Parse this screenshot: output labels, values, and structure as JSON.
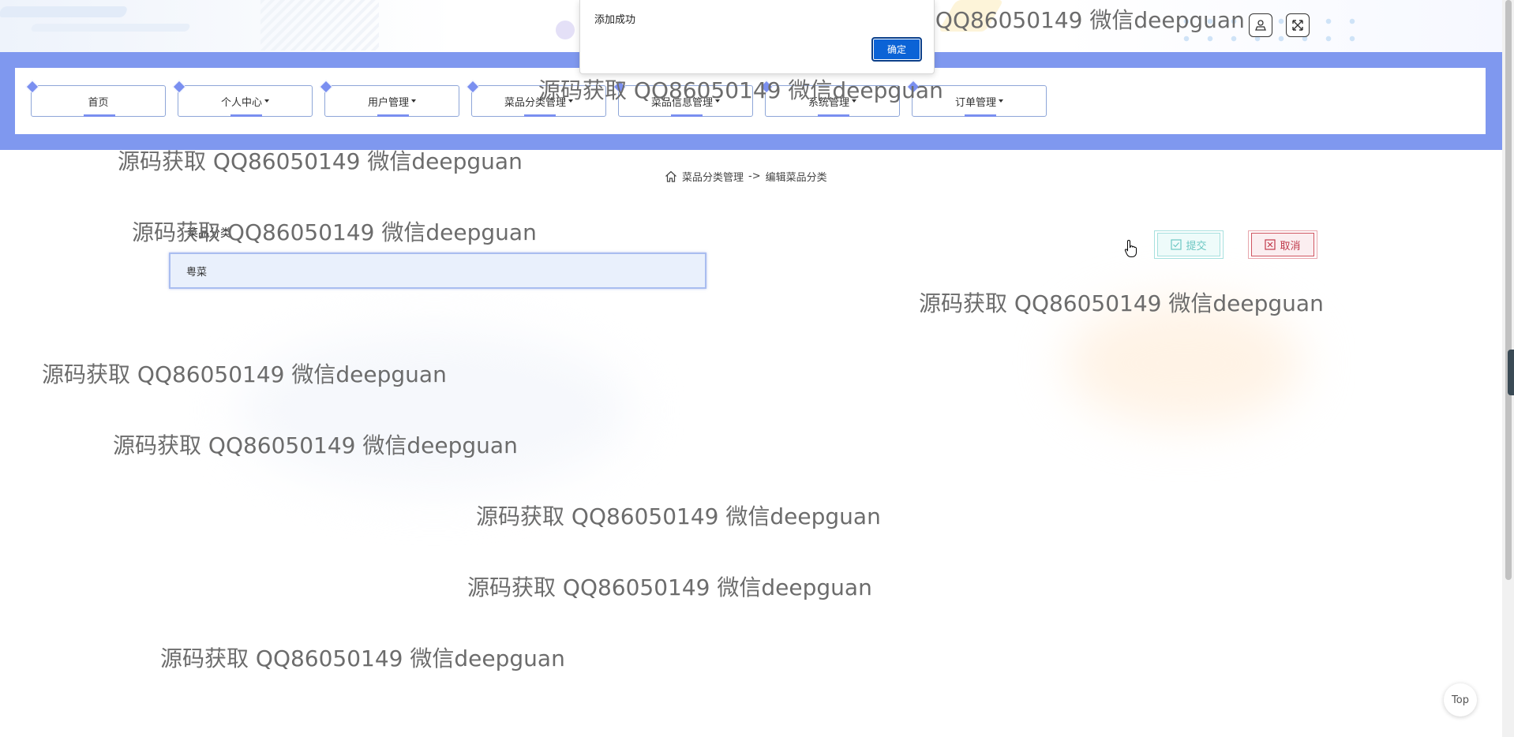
{
  "nav": {
    "items": [
      {
        "label": "首页",
        "dropdown": false
      },
      {
        "label": "个人中心",
        "dropdown": true
      },
      {
        "label": "用户管理",
        "dropdown": true
      },
      {
        "label": "菜品分类管理",
        "dropdown": true
      },
      {
        "label": "菜品信息管理",
        "dropdown": true
      },
      {
        "label": "系统管理",
        "dropdown": true
      },
      {
        "label": "订单管理",
        "dropdown": true
      }
    ],
    "color": "#7f98ef"
  },
  "header": {
    "icons": [
      "user-icon",
      "fullscreen-icon"
    ]
  },
  "breadcrumb": {
    "icon": "home-icon",
    "parent": "菜品分类管理",
    "separator": "->",
    "current": "编辑菜品分类"
  },
  "form": {
    "label": "菜品分类",
    "value": "粤菜",
    "submit_label": "提交",
    "cancel_label": "取消"
  },
  "dialog": {
    "message": "添加成功",
    "ok_label": "确定"
  },
  "top_button": "Top",
  "watermark": "源码获取 QQ86050149 微信deepguan"
}
